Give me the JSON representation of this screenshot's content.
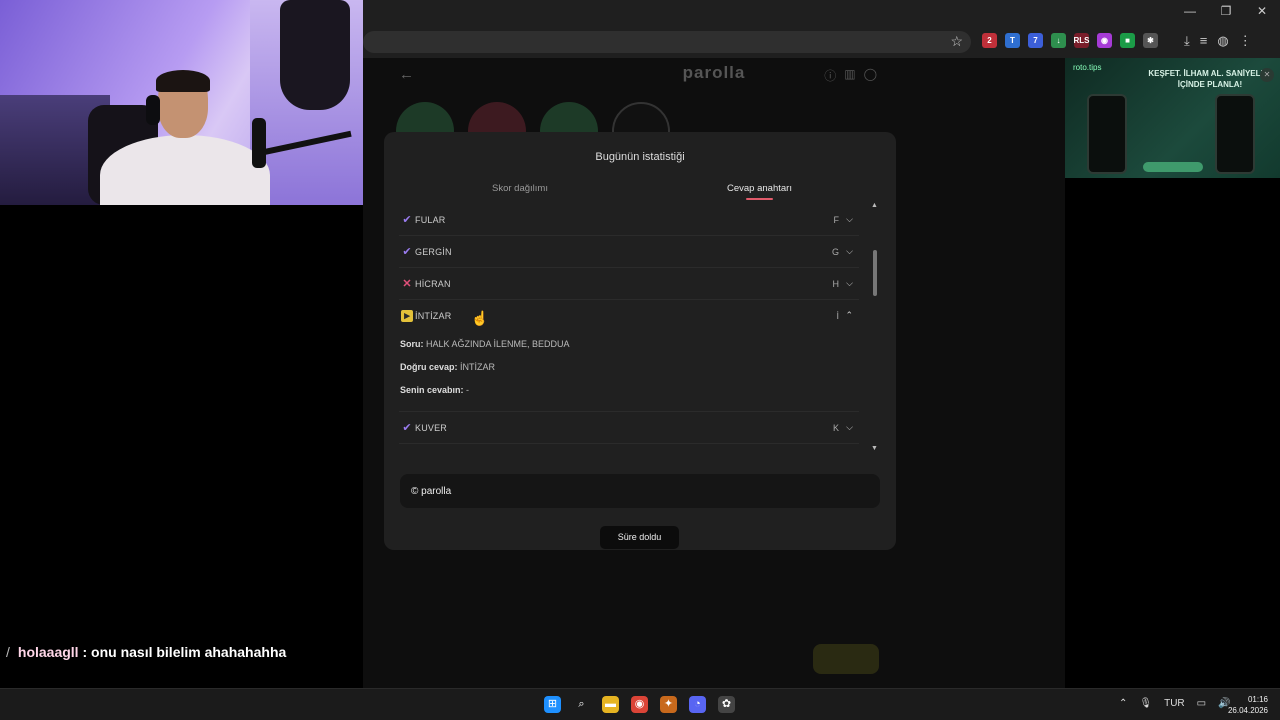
{
  "browser": {
    "window_controls": [
      "—",
      "❐",
      "✕"
    ],
    "star_glyph": "☆",
    "extensions": [
      {
        "name": "ext-1",
        "label": "2",
        "color": "#c0303a"
      },
      {
        "name": "ext-2",
        "label": "T",
        "color": "#2f6fd0"
      },
      {
        "name": "ext-3",
        "label": "7",
        "color": "#3c5fd9"
      },
      {
        "name": "ext-4",
        "label": "↓",
        "color": "#2e8f4e"
      },
      {
        "name": "ext-5",
        "label": "RLS",
        "color": "#7a1d2a"
      },
      {
        "name": "ext-6",
        "label": "◉",
        "color": "#a63bd6"
      },
      {
        "name": "ext-7",
        "label": "■",
        "color": "#1b9c47"
      },
      {
        "name": "ext-8",
        "label": "✱",
        "color": "#555555"
      }
    ],
    "tools": [
      "⤓",
      "≡",
      "◍",
      "⋮"
    ]
  },
  "site": {
    "brand": "parolla",
    "back_glyph": "←",
    "header_icons": [
      "ⓘ",
      "▥",
      "◯"
    ]
  },
  "modal": {
    "title": "Bugünün istatistiği",
    "tabs": [
      "Skor dağılımı",
      "Cevap anahtarı"
    ],
    "active_tab": "Cevap anahtarı",
    "rows": [
      {
        "word": "FULAR",
        "letter": "F",
        "status": "correct",
        "mark": "✔",
        "chevron": "⌵",
        "expanded": false
      },
      {
        "word": "GERGİN",
        "letter": "G",
        "status": "correct",
        "mark": "✔",
        "chevron": "⌵",
        "expanded": false
      },
      {
        "word": "HİCRAN",
        "letter": "H",
        "status": "wrong",
        "mark": "✕",
        "chevron": "⌵",
        "expanded": false
      },
      {
        "word": "İNTİZAR",
        "letter": "İ",
        "status": "passed",
        "mark": "▸",
        "chevron": "⌃",
        "expanded": true
      },
      {
        "word": "KUVER",
        "letter": "K",
        "status": "correct",
        "mark": "✔",
        "chevron": "⌵",
        "expanded": false
      }
    ],
    "detail": {
      "question_label": "Soru:",
      "question": "HALK AĞZINDA İLENME, BEDDUA",
      "answer_label": "Doğru cevap:",
      "answer": "İNTİZAR",
      "your_label": "Senin cevabın:",
      "your_answer": "-"
    },
    "scroll_up": "▲",
    "scroll_down": "▼",
    "footer": "© parolla",
    "time_button": "Süre doldu"
  },
  "ad": {
    "label": "roto.tips",
    "headline": "KEŞFET. İLHAM AL. SANİYELER İÇİNDE PLANLA!",
    "close": "✕"
  },
  "chat": {
    "slash": "/",
    "user": "holaaagll",
    "message": ": onu nasıl bilelim ahahahahha"
  },
  "taskbar": {
    "icons": [
      {
        "name": "windows-start-icon",
        "glyph": "⊞",
        "color": "#1e90ff"
      },
      {
        "name": "search-icon",
        "glyph": "⌕",
        "color": "transparent"
      },
      {
        "name": "file-explorer-icon",
        "glyph": "▬",
        "color": "#e6b422"
      },
      {
        "name": "chrome-icon",
        "glyph": "◉",
        "color": "#db4437"
      },
      {
        "name": "fl-studio-icon",
        "glyph": "✦",
        "color": "#c8691c"
      },
      {
        "name": "discord-icon",
        "glyph": "◔",
        "color": "#5865f2"
      },
      {
        "name": "app-icon",
        "glyph": "✿",
        "color": "#444444"
      }
    ],
    "tray_chevron": "⌃",
    "mic": "🎙",
    "language": "TUR",
    "monitor": "▭",
    "volume": "🔊",
    "time": "01:16",
    "date": "26.04.2026"
  }
}
